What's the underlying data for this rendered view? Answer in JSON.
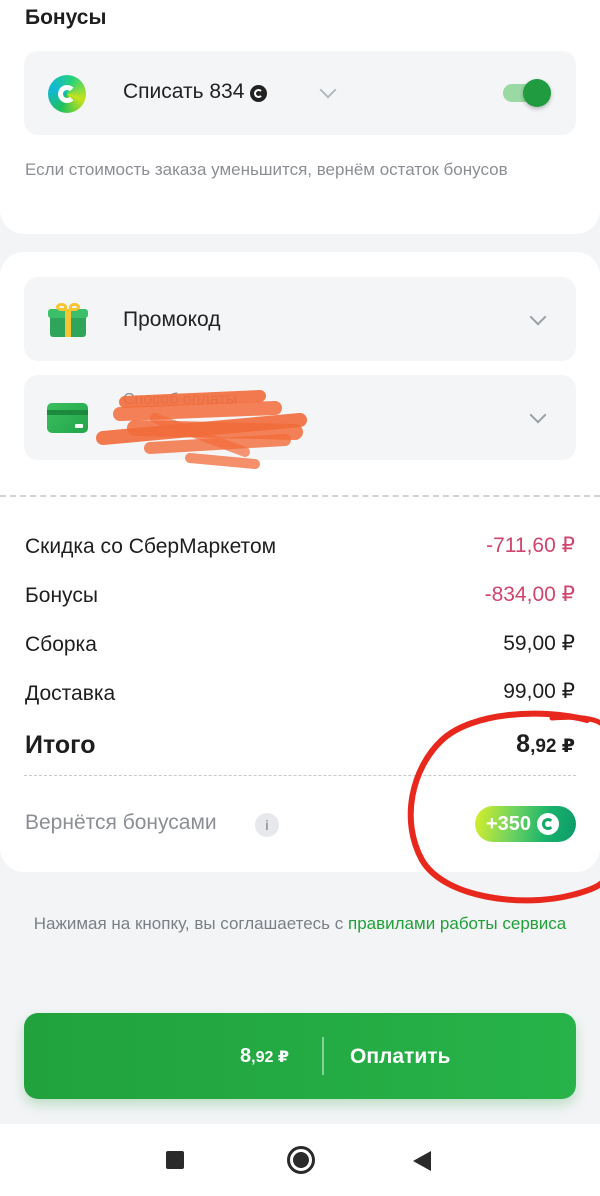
{
  "bonus": {
    "title": "Бонусы",
    "toggle_label": "Списать 834",
    "toggle_on": true,
    "note": "Если стоимость заказа уменьшится, вернём остаток бонусов",
    "icon": "sber-bonus-logo-icon"
  },
  "promo": {
    "label": "Промокод",
    "icon": "gift-icon"
  },
  "payment_method": {
    "label": "Способ оплаты",
    "icon": "bank-card-icon",
    "value_redacted": true
  },
  "summary": {
    "lines": [
      {
        "label": "Скидка со СберМаркетом",
        "value": "-711,60 ₽",
        "negative": true
      },
      {
        "label": "Бонусы",
        "value": "-834,00 ₽",
        "negative": true
      },
      {
        "label": "Сборка",
        "value": "59,00 ₽",
        "negative": false
      },
      {
        "label": "Доставка",
        "value": "99,00 ₽",
        "negative": false
      }
    ],
    "total_label": "Итого",
    "total_main": "8",
    "total_cents": ",92 ₽",
    "return_label": "Вернётся бонусами",
    "return_value": "+350"
  },
  "terms": {
    "text": "Нажимая на кнопку, вы соглашаетесь с ",
    "link": "правилами работы сервиса"
  },
  "pay_button": {
    "amount_main": "8",
    "amount_cents": ",92 ₽",
    "label": "Оплатить"
  },
  "colors": {
    "accent_green": "#21a23d",
    "negative": "#d1456d",
    "annotation_red": "#e8281c"
  }
}
